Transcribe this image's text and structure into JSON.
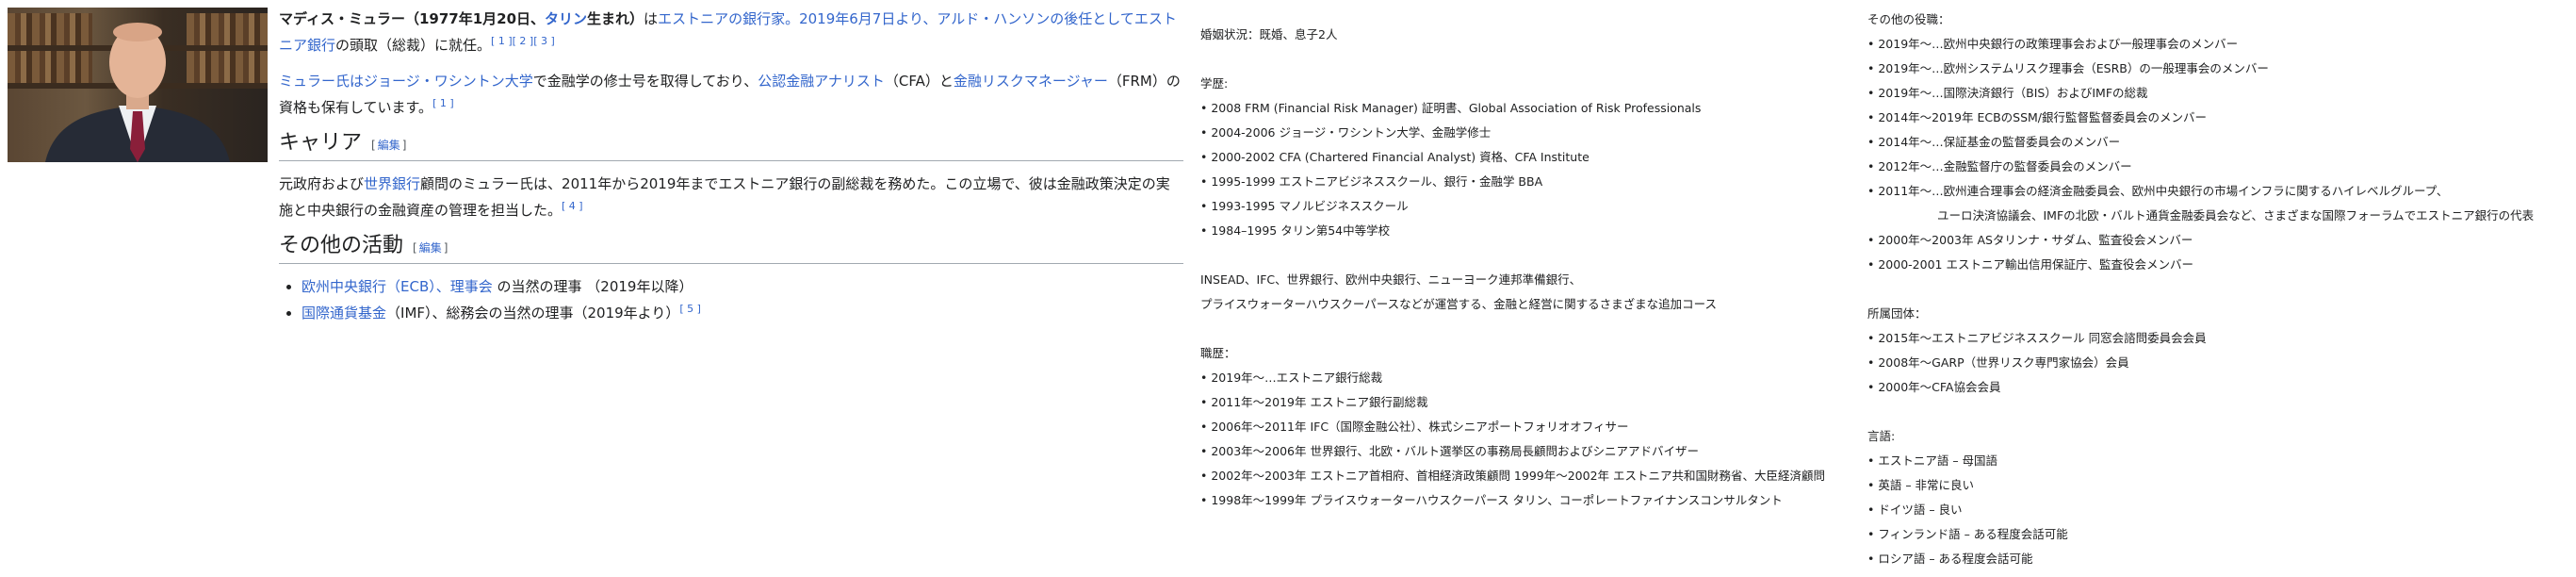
{
  "intro": {
    "name_bold": "マディス・ミュラー（1977年1月20日、",
    "born_link": "タリン",
    "born_suffix": "生まれ）",
    "bold_tail": "は",
    "role_link": "エストニアの銀行家。2019年6月7日より、アルド・ハンソンの後任としてエストニア銀行",
    "role_suffix": "の頭取（総裁）に就任。",
    "refs": [
      "[ 1 ]",
      "[ 2 ]",
      "[ 3 ]"
    ]
  },
  "education_para": {
    "link1": "ミュラー氏はジョージ・ワシントン大学",
    "text1": "で金融学の修士号を取得しており、",
    "link2": "公認金融アナリスト",
    "text2": "（CFA）と",
    "link3": "金融リスクマネージャー",
    "text3": "（FRM）の資格も保有しています。",
    "ref": "[ 1 ]"
  },
  "career": {
    "heading": "キャリア",
    "edit_open": "[",
    "edit_label": "編集",
    "edit_close": "]",
    "text1": "元政府および",
    "link": "世界銀行",
    "text2": "顧問のミュラー氏は、2011年から2019年までエストニア銀行の副総裁を務めた。この立場で、彼は金融政策決定の実施と中央銀行の金融資産の管理を担当した。",
    "ref": "[ 4 ]"
  },
  "activities": {
    "heading": "その他の活動",
    "edit_open": "[",
    "edit_label": "編集",
    "edit_close": "]",
    "items": [
      {
        "link": "欧州中央銀行（ECB）、理事会",
        "text": " の当然の理事 （2019年以降）",
        "ref": ""
      },
      {
        "link": "国際通貨基金",
        "text": "（IMF）、総務会の当然の理事（2019年より）",
        "ref": "[ 5 ]"
      }
    ]
  },
  "col2": {
    "marital": "婚姻状況：既婚、息子2人",
    "education_label": "学歴:",
    "education": [
      "• 2008 FRM (Financial Risk Manager) 証明書、Global Association of Risk Professionals",
      "• 2004-2006 ジョージ・ワシントン大学、金融学修士",
      "• 2000-2002 CFA (Chartered Financial Analyst) 資格、CFA Institute",
      "• 1995-1999 エストニアビジネススクール、銀行・金融学 BBA",
      "• 1993-1995 マノルビジネススクール",
      "• 1984–1995 タリン第54中等学校"
    ],
    "courses": [
      "INSEAD、IFC、世界銀行、欧州中央銀行、ニューヨーク連邦準備銀行、",
      "プライスウォーターハウスクーパースなどが運営する、金融と経営に関するさまざまな追加コース"
    ],
    "jobs_label": "職歴：",
    "jobs": [
      "• 2019年～…エストニア銀行総裁",
      "• 2011年～2019年 エストニア銀行副総裁",
      "• 2006年～2011年 IFC（国際金融公社）、株式シニアポートフォリオオフィサー",
      "• 2003年～2006年 世界銀行、北欧・バルト選挙区の事務局長顧問およびシニアアドバイザー",
      "• 2002年～2003年 エストニア首相府、首相経済政策顧問 1999年～2002年 エストニア共和国財務省、大臣経済顧問",
      "• 1998年～1999年 プライスウォーターハウスクーパース タリン、コーポレートファイナンスコンサルタント"
    ]
  },
  "col3": {
    "other_label": "その他の役職：",
    "other": [
      "• 2019年～…欧州中央銀行の政策理事会および一般理事会のメンバー",
      "• 2019年～…欧州システムリスク理事会（ESRB）の一般理事会のメンバー",
      "• 2019年～…国際決済銀行（BIS）およびIMFの総裁",
      "• 2014年～2019年 ECBのSSM/銀行監督監督委員会のメンバー",
      "• 2014年～…保証基金の監督委員会のメンバー",
      "• 2012年～…金融監督庁の監督委員会のメンバー",
      "• 2011年～…欧州連合理事会の経済金融委員会、欧州中央銀行の市場インフラに関するハイレベルグループ、",
      "ユーロ決済協議会、IMFの北欧・バルト通貨金融委員会など、さまざまな国際フォーラムでエストニア銀行の代表",
      "• 2000年～2003年 ASタリンナ・サダム、監査役会メンバー",
      "• 2000-2001 エストニア輸出信用保証庁、監査役会メンバー"
    ],
    "org_label": "所属団体：",
    "orgs": [
      "• 2015年～エストニアビジネススクール 同窓会諮問委員会会員",
      "• 2008年～GARP（世界リスク専門家協会）会員",
      "• 2000年～CFA協会会員"
    ],
    "lang_label": "言語:",
    "languages": [
      "• エストニア語 – 母国語",
      "• 英語 – 非常に良い",
      "• ドイツ語 – 良い",
      "• フィンランド語 – ある程度会話可能",
      "• ロシア語 – ある程度会話可能"
    ]
  }
}
